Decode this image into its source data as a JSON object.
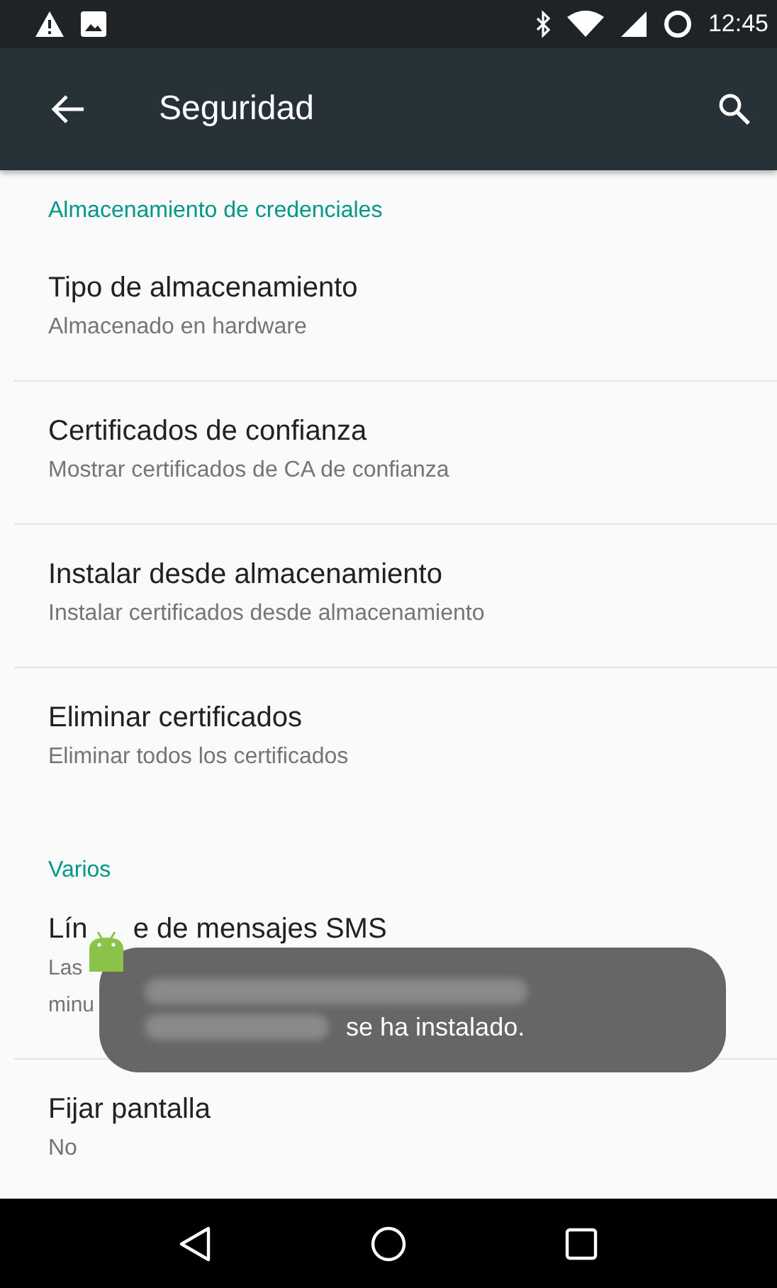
{
  "status_bar": {
    "time": "12:45"
  },
  "app_bar": {
    "title": "Seguridad"
  },
  "sections": [
    {
      "header": "Almacenamiento de credenciales",
      "items": [
        {
          "kind": "normal",
          "title": "Tipo de almacenamiento",
          "subtitle": "Almacenado en hardware"
        },
        {
          "kind": "normal",
          "title": "Certificados de confianza",
          "subtitle": "Mostrar certificados de CA de confianza"
        },
        {
          "kind": "normal",
          "title": "Instalar desde almacenamiento",
          "subtitle": "Instalar certificados desde almacenamiento"
        },
        {
          "kind": "normal",
          "title": "Eliminar certificados",
          "subtitle": "Eliminar todos los certificados"
        }
      ]
    },
    {
      "header": "Varios",
      "items": [
        {
          "kind": "covered",
          "title_parts": [
            "Lín",
            "e de mensajes SMS"
          ],
          "subtitle_parts": [
            "Las",
            "minu"
          ]
        },
        {
          "kind": "normal",
          "title": "Fijar pantalla",
          "subtitle": "No"
        }
      ]
    }
  ],
  "toast": {
    "message": "se ha instalado."
  }
}
